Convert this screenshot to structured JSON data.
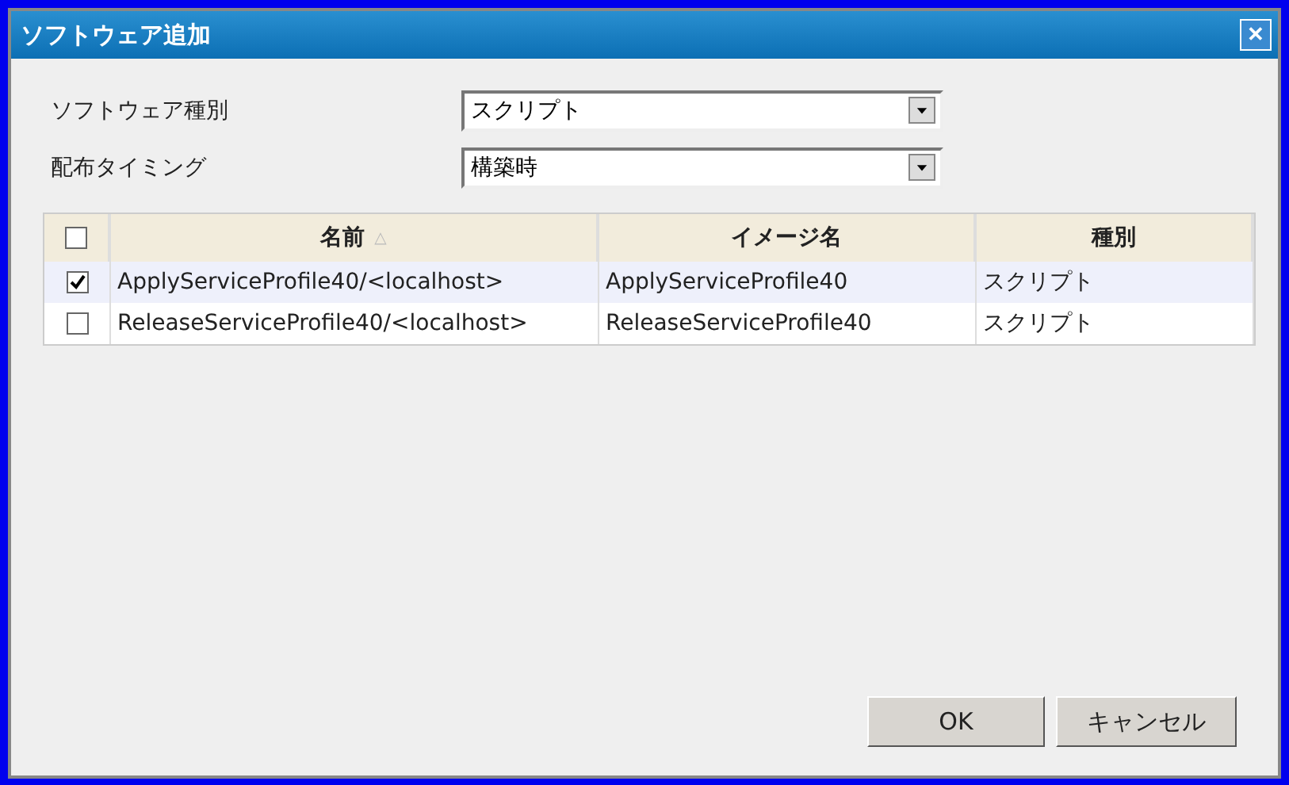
{
  "window": {
    "title": "ソフトウェア追加",
    "close": "✕"
  },
  "form": [
    {
      "label": "ソフトウェア種別",
      "value": "スクリプト"
    },
    {
      "label": "配布タイミング",
      "value": "構築時"
    }
  ],
  "table": {
    "select_all": {
      "checked": false
    },
    "columns": [
      {
        "label": "名前",
        "sort": "△"
      },
      {
        "label": "イメージ名"
      },
      {
        "label": "種別"
      }
    ],
    "rows": [
      {
        "checked": true,
        "selected": true,
        "cells": [
          "ApplyServiceProfile40/<localhost>",
          "ApplyServiceProfile40",
          "スクリプト"
        ]
      },
      {
        "checked": false,
        "selected": false,
        "cells": [
          "ReleaseServiceProfile40/<localhost>",
          "ReleaseServiceProfile40",
          "スクリプト"
        ]
      }
    ]
  },
  "buttons": [
    {
      "label": "OK"
    },
    {
      "label": "キャンセル"
    }
  ]
}
